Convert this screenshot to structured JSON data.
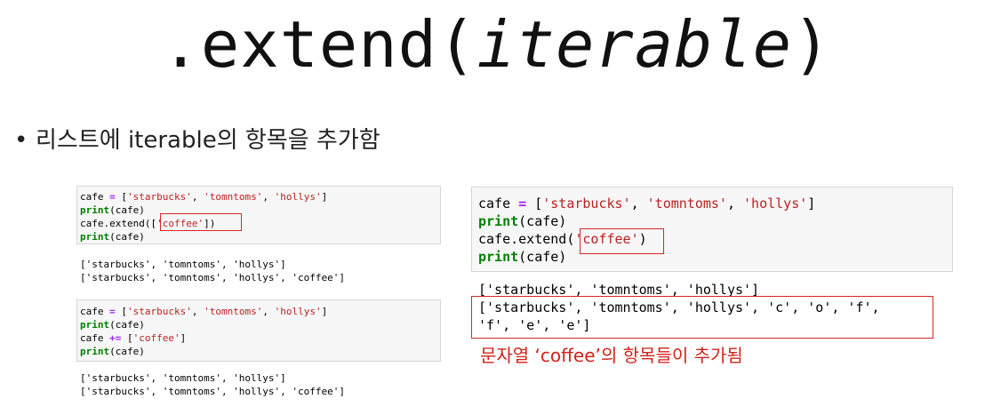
{
  "title": {
    "prefix": ".extend(",
    "param": "iterable",
    "suffix": ")"
  },
  "bullet": {
    "dot": "•",
    "text": "리스트에 iterable의 항목을 추가함"
  },
  "left_cell1": {
    "code": [
      "cafe = ['starbucks', 'tomntoms', 'hollys']",
      "print(cafe)",
      "cafe.extend(['coffee'])",
      "print(cafe)"
    ],
    "output": [
      "['starbucks', 'tomntoms', 'hollys']",
      "['starbucks', 'tomntoms', 'hollys', 'coffee']"
    ]
  },
  "left_cell2": {
    "code": [
      "cafe = ['starbucks', 'tomntoms', 'hollys']",
      "print(cafe)",
      "cafe += ['coffee']",
      "print(cafe)"
    ],
    "output": [
      "['starbucks', 'tomntoms', 'hollys']",
      "['starbucks', 'tomntoms', 'hollys', 'coffee']"
    ]
  },
  "right_cell": {
    "code": [
      "cafe = ['starbucks', 'tomntoms', 'hollys']",
      "print(cafe)",
      "cafe.extend('coffee')",
      "print(cafe)"
    ],
    "output": [
      "['starbucks', 'tomntoms', 'hollys']",
      "['starbucks', 'tomntoms', 'hollys', 'c', 'o', 'f',",
      "'f', 'e', 'e']"
    ]
  },
  "note": "문자열 ‘coffee’의 항목들이 추가됨",
  "colors": {
    "string": "#ba2121",
    "keyword": "#008000",
    "operator": "#aa22ff",
    "highlight": "#d62728"
  }
}
